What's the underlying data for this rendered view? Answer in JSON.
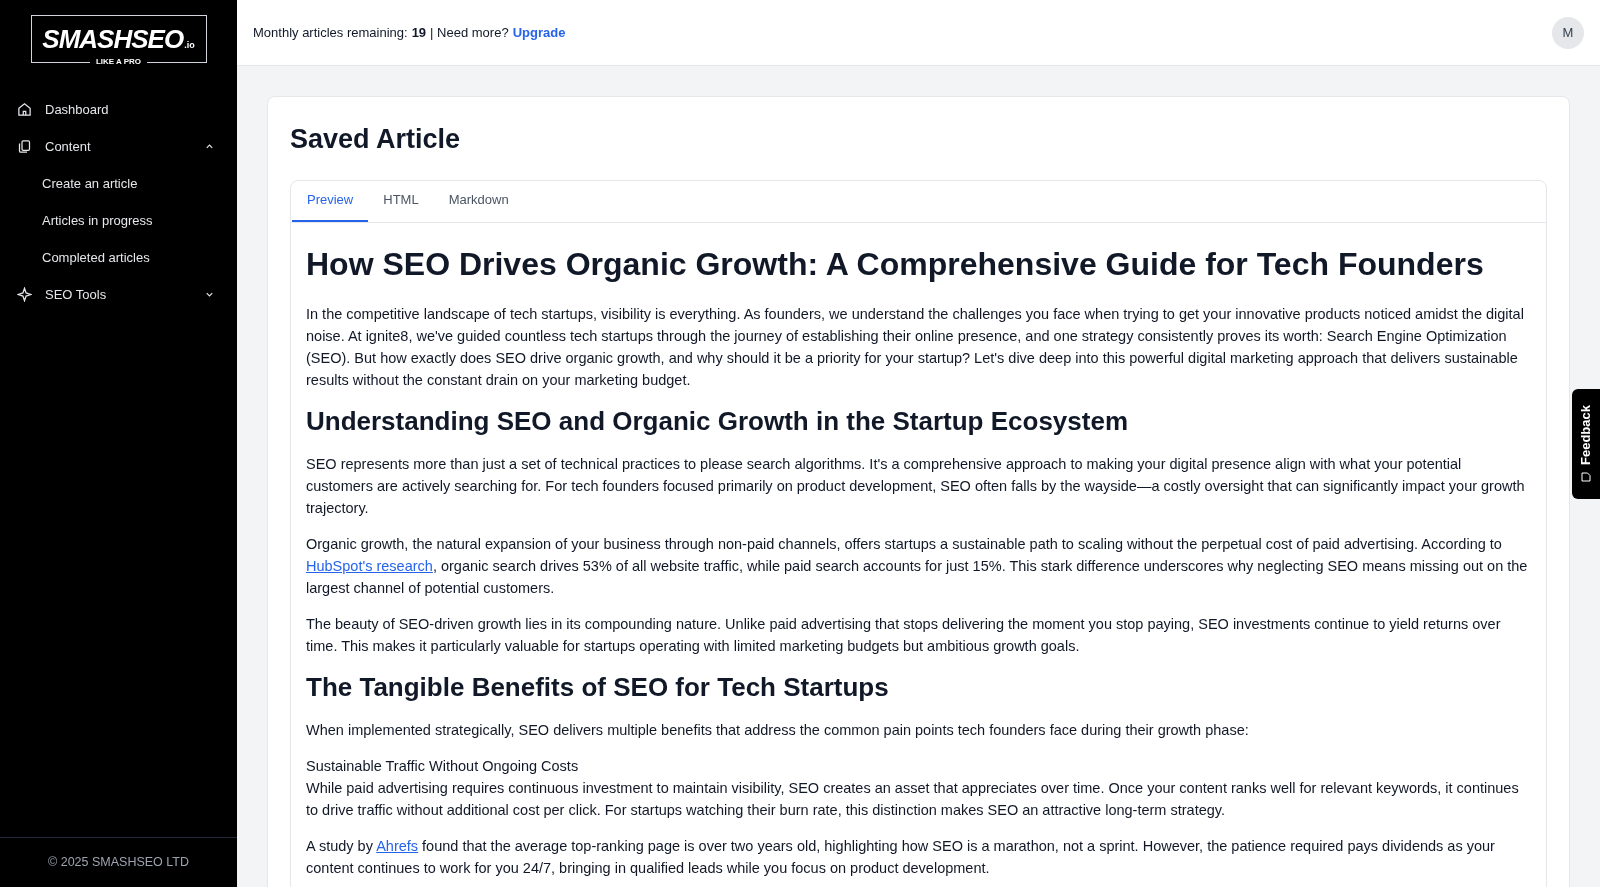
{
  "logo": {
    "name": "SMASHSEO",
    "suffix": ".io",
    "tagline": "LIKE A PRO"
  },
  "sidebar": {
    "items": [
      {
        "label": "Dashboard",
        "kind": "home"
      },
      {
        "label": "Content",
        "kind": "docs",
        "expanded": true,
        "children": [
          {
            "label": "Create an article"
          },
          {
            "label": "Articles in progress"
          },
          {
            "label": "Completed articles"
          }
        ]
      },
      {
        "label": "SEO Tools",
        "kind": "sparkle",
        "expanded": false
      }
    ],
    "footer": "© 2025 SMASHSEO LTD"
  },
  "header": {
    "quota_label": "Monthly articles remaining:",
    "quota_value": "19",
    "more": "| Need more?",
    "upgrade": "Upgrade",
    "avatar": "M"
  },
  "page": {
    "title": "Saved Article",
    "tabs": [
      {
        "label": "Preview",
        "selected": true
      },
      {
        "label": "HTML",
        "selected": false
      },
      {
        "label": "Markdown",
        "selected": false
      }
    ],
    "article": [
      {
        "kind": "h1",
        "text": "How SEO Drives Organic Growth: A Comprehensive Guide for Tech Founders"
      },
      {
        "kind": "p",
        "text": "In the competitive landscape of tech startups, visibility is everything. As founders, we understand the challenges you face when trying to get your innovative products noticed amidst the digital noise. At ignite8, we've guided countless tech startups through the journey of establishing their online presence, and one strategy consistently proves its worth: Search Engine Optimization (SEO). But how exactly does SEO drive organic growth, and why should it be a priority for your startup? Let's dive deep into this powerful digital marketing approach that delivers sustainable results without the constant drain on your marketing budget."
      },
      {
        "kind": "h2",
        "text": "Understanding SEO and Organic Growth in the Startup Ecosystem"
      },
      {
        "kind": "p",
        "text": "SEO represents more than just a set of technical practices to please search algorithms. It's a comprehensive approach to making your digital presence align with what your potential customers are actively searching for. For tech founders focused primarily on product development, SEO often falls by the wayside—a costly oversight that can significantly impact your growth trajectory."
      },
      {
        "kind": "p",
        "before": "Organic growth, the natural expansion of your business through non-paid channels, offers startups a sustainable path to scaling without the perpetual cost of paid advertising. According to ",
        "link": "HubSpot's research",
        "after": ", organic search drives 53% of all website traffic, while paid search accounts for just 15%. This stark difference underscores why neglecting SEO means missing out on the largest channel of potential customers."
      },
      {
        "kind": "p",
        "text": "The beauty of SEO-driven growth lies in its compounding nature. Unlike paid advertising that stops delivering the moment you stop paying, SEO investments continue to yield returns over time. This makes it particularly valuable for startups operating with limited marketing budgets but ambitious growth goals."
      },
      {
        "kind": "h2",
        "text": "The Tangible Benefits of SEO for Tech Startups"
      },
      {
        "kind": "p",
        "text": "When implemented strategically, SEO delivers multiple benefits that address the common pain points tech founders face during their growth phase:"
      },
      {
        "kind": "pt",
        "heading": "Sustainable Traffic Without Ongoing Costs",
        "text": "While paid advertising requires continuous investment to maintain visibility, SEO creates an asset that appreciates over time. Once your content ranks well for relevant keywords, it continues to drive traffic without additional cost per click. For startups watching their burn rate, this distinction makes SEO an attractive long-term strategy."
      },
      {
        "kind": "p",
        "before": "A study by ",
        "link": "Ahrefs",
        "after": " found that the average top-ranking page is over two years old, highlighting how SEO is a marathon, not a sprint. However, the patience required pays dividends as your content continues to work for you 24/7, bringing in qualified leads while you focus on product development."
      }
    ]
  },
  "feedback": {
    "label": "Feedback"
  }
}
